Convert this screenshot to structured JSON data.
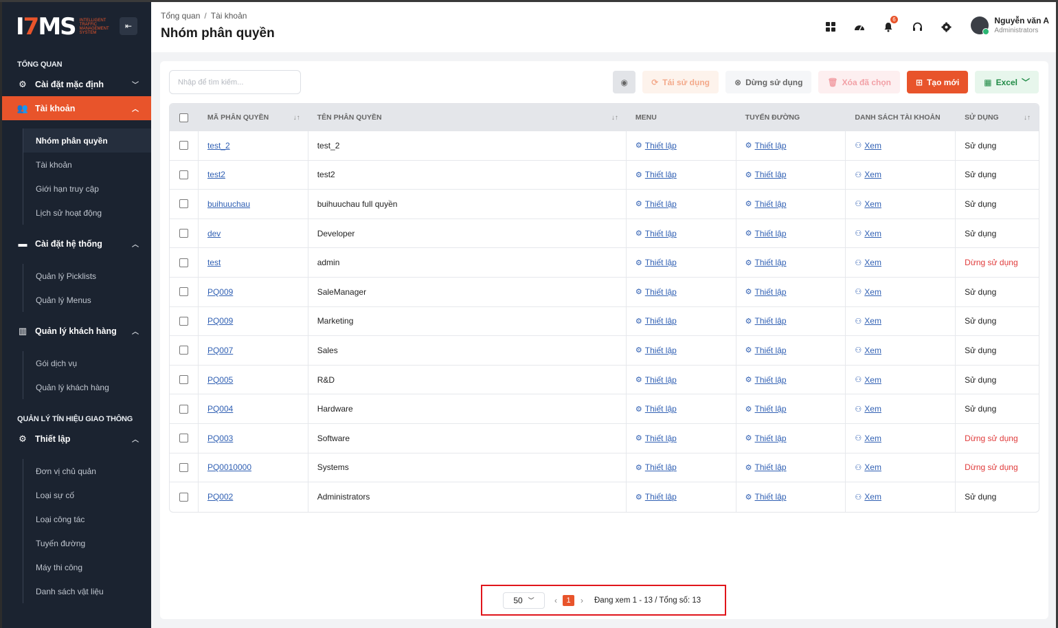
{
  "app": {
    "logo_main": "ITMS",
    "logo_sub": [
      "INTELLIGENT",
      "TRAFFIC",
      "MANAGEMENT",
      "SYSTEM"
    ]
  },
  "sidebar": {
    "section1": "TỔNG QUAN",
    "group_default": "Cài đặt mặc định",
    "group_accounts": "Tài khoản",
    "accounts_items": [
      "Nhóm phân quyền",
      "Tài khoản",
      "Giới hạn truy cập",
      "Lịch sử hoạt động"
    ],
    "group_system": "Cài đặt hệ thống",
    "system_items": [
      "Quản lý Picklists",
      "Quản lý Menus"
    ],
    "group_customers": "Quản lý khách hàng",
    "customers_items": [
      "Gói dịch vụ",
      "Quản lý khách hàng"
    ],
    "section2": "QUẢN LÝ TÍN HIỆU GIAO THÔNG",
    "group_setup": "Thiết lập",
    "setup_items": [
      "Đơn vị chủ quản",
      "Loại sự cố",
      "Loại công tác",
      "Tuyến đường",
      "Máy thi công",
      "Danh sách vật liệu"
    ]
  },
  "header": {
    "breadcrumb_home": "Tổng quan",
    "breadcrumb_sep": "/",
    "breadcrumb_current": "Tài khoản",
    "title": "Nhóm phân quyền",
    "notification_count": "6",
    "user_name": "Nguyễn văn A",
    "user_role": "Administrators"
  },
  "toolbar": {
    "search_placeholder": "Nhập để tìm kiếm...",
    "reuse": "Tái sử dụng",
    "stop": "Dừng sử dụng",
    "delete": "Xóa đã chọn",
    "create": "Tạo mới",
    "excel": "Excel"
  },
  "table": {
    "headers": [
      "MÃ PHÂN QUYỀN",
      "TÊN PHÂN QUYỀN",
      "MENU",
      "TUYẾN ĐƯỜNG",
      "DANH SÁCH TÀI KHOẢN",
      "SỬ DỤNG"
    ],
    "setup_label": "Thiết lập",
    "view_label": "Xem",
    "rows": [
      {
        "code": "test_2",
        "name": "test_2",
        "status": "Sử dụng"
      },
      {
        "code": "test2",
        "name": "test2",
        "status": "Sử dụng"
      },
      {
        "code": "buihuuchau",
        "name": "buihuuchau full quyền",
        "status": "Sử dụng"
      },
      {
        "code": "dev",
        "name": "Developer",
        "status": "Sử dụng"
      },
      {
        "code": "test",
        "name": "admin",
        "status": "Dừng sử dụng"
      },
      {
        "code": "PQ009",
        "name": "SaleManager",
        "status": "Sử dụng"
      },
      {
        "code": "PQ009",
        "name": "Marketing",
        "status": "Sử dụng"
      },
      {
        "code": "PQ007",
        "name": "Sales",
        "status": "Sử dụng"
      },
      {
        "code": "PQ005",
        "name": "R&D",
        "status": "Sử dụng"
      },
      {
        "code": "PQ004",
        "name": "Hardware",
        "status": "Sử dụng"
      },
      {
        "code": "PQ003",
        "name": "Software",
        "status": "Dừng sử dụng"
      },
      {
        "code": "PQ0010000",
        "name": "Systems",
        "status": "Dừng sử dụng"
      },
      {
        "code": "PQ002",
        "name": "Administrators",
        "status": "Sử dụng"
      }
    ]
  },
  "pagination": {
    "page_size": "50",
    "current_page": "1",
    "info": "Đang xem 1 - 13 / Tổng số: 13"
  },
  "colors": {
    "accent": "#e8542b",
    "sidebar_bg": "#1b2330",
    "inactive_status": "#e03a3a",
    "link": "#2f5fb3"
  }
}
